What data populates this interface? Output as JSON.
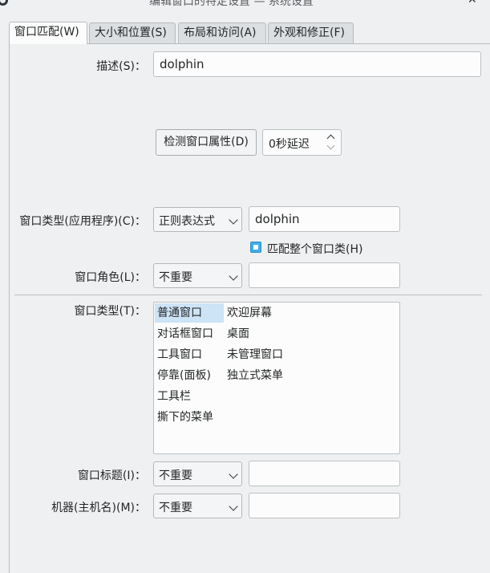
{
  "window": {
    "title": "编辑窗口的特定设置 — 系统设置"
  },
  "tabs": [
    {
      "label": "窗口匹配(W)",
      "active": true
    },
    {
      "label": "大小和位置(S)",
      "active": false
    },
    {
      "label": "布局和访问(A)",
      "active": false
    },
    {
      "label": "外观和修正(F)",
      "active": false
    }
  ],
  "description": {
    "label": "描述(S)：",
    "value": "dolphin"
  },
  "detect": {
    "button_label": "检测窗口属性(D)",
    "delay_value": "0秒延迟"
  },
  "window_class": {
    "label": "窗口类型(应用程序)(C)：",
    "match_mode": "正则表达式",
    "value": "dolphin",
    "match_whole_label": "匹配整个窗口类(H)",
    "match_whole_checked": true
  },
  "window_role": {
    "label": "窗口角色(L)：",
    "match_mode": "不重要",
    "value": ""
  },
  "window_types": {
    "label": "窗口类型(T)：",
    "column1": [
      "普通窗口",
      "对话框窗口",
      "工具窗口",
      "停靠(面板)",
      "工具栏",
      "撕下的菜单"
    ],
    "column2": [
      "欢迎屏幕",
      "桌面",
      "未管理窗口",
      "独立式菜单"
    ],
    "selected": "普通窗口"
  },
  "window_title": {
    "label": "窗口标题(I)：",
    "match_mode": "不重要",
    "value": ""
  },
  "machine": {
    "label": "机器(主机名)(M)：",
    "match_mode": "不重要",
    "value": ""
  },
  "colors": {
    "accent": "#3daee9",
    "selection": "#cde3f6",
    "background": "#eff0f1"
  }
}
